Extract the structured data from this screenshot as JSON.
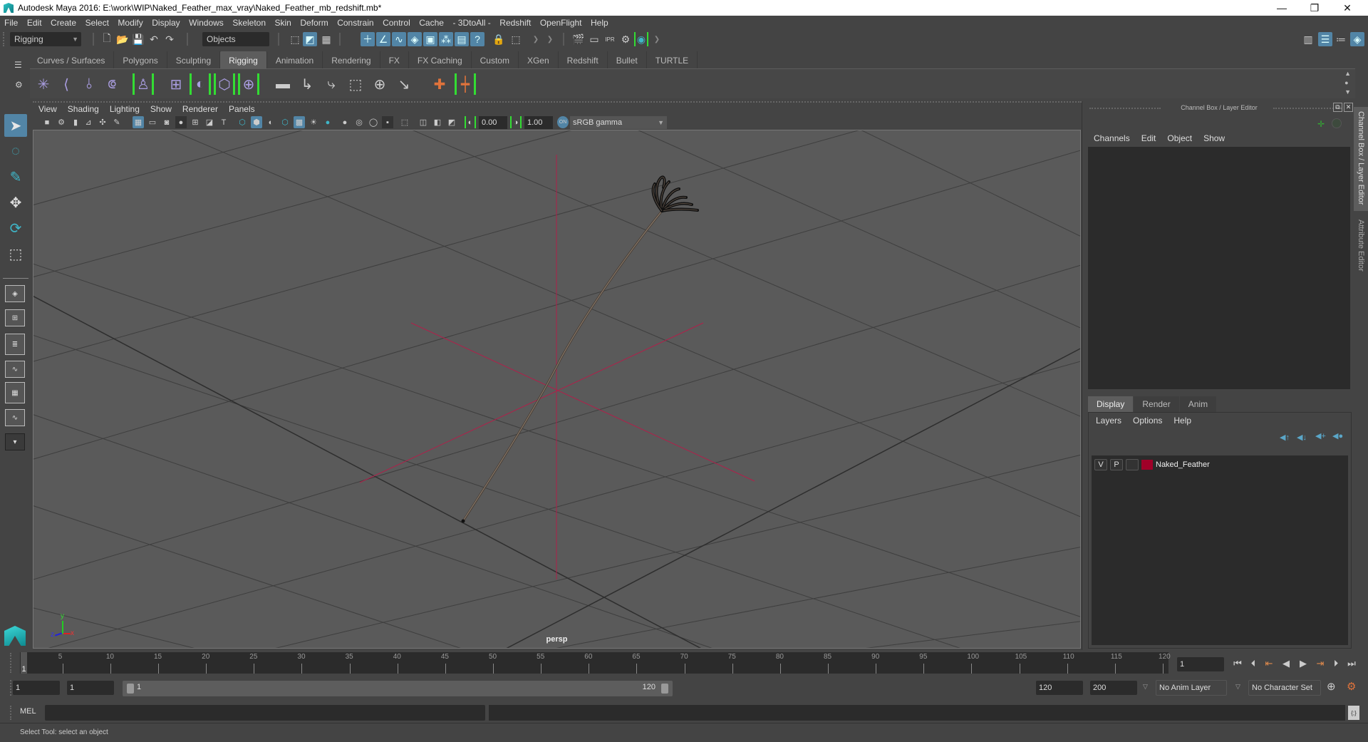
{
  "window": {
    "title": "Autodesk Maya 2016: E:\\work\\WIP\\Naked_Feather_max_vray\\Naked_Feather_mb_redshift.mb*",
    "controls": {
      "minimize": "—",
      "restore": "❐",
      "close": "✕"
    }
  },
  "menubar": [
    "File",
    "Edit",
    "Create",
    "Select",
    "Modify",
    "Display",
    "Windows",
    "Skeleton",
    "Skin",
    "Deform",
    "Constrain",
    "Control",
    "Cache",
    "- 3DtoAll -",
    "Redshift",
    "OpenFlight",
    "Help"
  ],
  "statusline": {
    "menuset": "Rigging",
    "selection_mode": "Objects",
    "icons": [
      "new-scene-icon",
      "open-scene-icon",
      "save-scene-icon",
      "undo-icon",
      "redo-icon",
      "select-by-hierarchy-icon",
      "select-by-object-icon",
      "select-by-component-icon",
      "snap-grid-icon",
      "snap-curve-icon",
      "snap-point-icon",
      "snap-surface-icon",
      "snap-view-plane-icon",
      "snap-live-icon",
      "render-icon",
      "help-icon",
      "lock-icon",
      "select-highlight-icon",
      "render-view-icon",
      "render-current-icon",
      "ipr-render-icon",
      "render-settings-icon",
      "hypershade-icon"
    ],
    "right_icons": [
      "modeling-toolkit-icon",
      "attribute-editor-icon",
      "tool-settings-icon",
      "channel-box-icon"
    ]
  },
  "shelf": {
    "tabs": [
      "Curves / Surfaces",
      "Polygons",
      "Sculpting",
      "Rigging",
      "Animation",
      "Rendering",
      "FX",
      "FX Caching",
      "Custom",
      "XGen",
      "Redshift",
      "Bullet",
      "TURTLE"
    ],
    "active_tab": "Rigging",
    "icons": [
      "joint-tool-icon",
      "ik-handle-icon",
      "ik-spline-icon",
      "insert-joint-icon",
      "quick-rig-icon",
      "paint-weights-icon",
      "smooth-bind-icon",
      "lattice-icon",
      "cluster-icon",
      "parent-constraint-icon",
      "point-constraint-icon",
      "orient-constraint-icon",
      "scale-constraint-icon",
      "aim-constraint-icon",
      "pole-vector-icon",
      "locator-icon",
      "parent-icon"
    ]
  },
  "toolbox": {
    "tools": [
      "select-tool-icon",
      "lasso-tool-icon",
      "paint-select-icon",
      "move-tool-icon",
      "rotate-tool-icon",
      "scale-tool-icon"
    ],
    "layouts": [
      "single-view-icon",
      "four-view-icon",
      "outliner-persp-icon",
      "graph-persp-icon",
      "hypershade-persp-icon",
      "uv-persp-icon",
      "more-layouts-icon"
    ]
  },
  "viewport": {
    "menu": [
      "View",
      "Shading",
      "Lighting",
      "Show",
      "Renderer",
      "Panels"
    ],
    "exposure": "0.00",
    "gamma": "1.00",
    "color_space": "sRGB gamma",
    "camera_label": "persp",
    "axis": {
      "x": "x",
      "y": "y",
      "z": "z"
    },
    "object": "Naked_Feather"
  },
  "channel_box": {
    "title": "Channel Box / Layer Editor",
    "menu": [
      "Channels",
      "Edit",
      "Object",
      "Show"
    ],
    "side_tabs": [
      "Channel Box / Layer Editor",
      "Attribute Editor"
    ]
  },
  "layer_editor": {
    "tabs": [
      "Display",
      "Render",
      "Anim"
    ],
    "active_tab": "Display",
    "menu": [
      "Layers",
      "Options",
      "Help"
    ],
    "layers": [
      {
        "visible": "V",
        "playback": "P",
        "name": "Naked_Feather",
        "color": "#a00028"
      }
    ]
  },
  "timeline": {
    "ticks": [
      5,
      10,
      15,
      20,
      25,
      30,
      35,
      40,
      45,
      50,
      55,
      60,
      65,
      70,
      75,
      80,
      85,
      90,
      95,
      100,
      105,
      110,
      115,
      120
    ],
    "start": 1,
    "end": 120,
    "current_frame": "1",
    "current_frame_field": "1"
  },
  "range": {
    "start_time": "1",
    "playback_start": "1",
    "slider_start": "1",
    "slider_end": "120",
    "playback_end": "120",
    "end_time": "200",
    "anim_layer": "No Anim Layer",
    "character_set": "No Character Set"
  },
  "command_line": {
    "label": "MEL",
    "value": ""
  },
  "help_line": "Select Tool: select an object",
  "colors": {
    "accent": "#5285a6",
    "shelf_bracket": "#33dd33",
    "layer_color": "#a00028",
    "axis_red": "#b0204a"
  }
}
